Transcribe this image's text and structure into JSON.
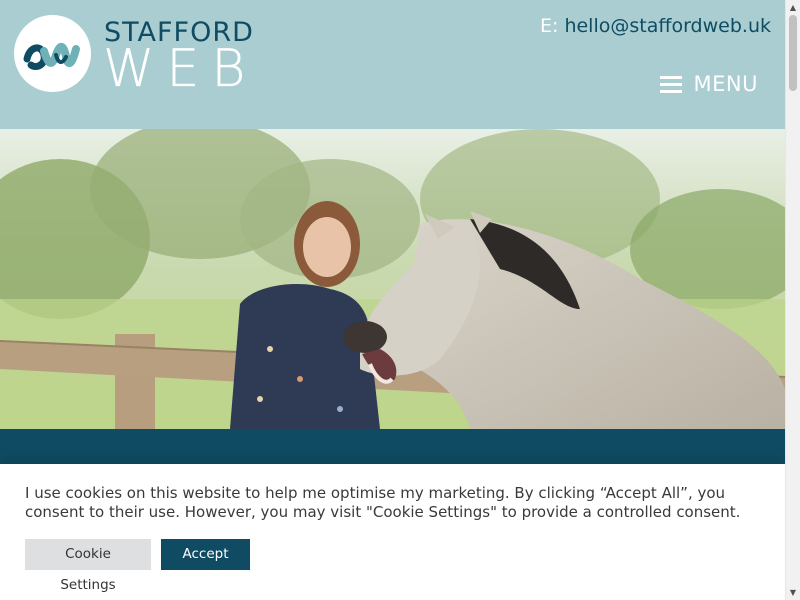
{
  "brand": {
    "logo_initials": "SW",
    "name_top": "STAFFORD",
    "name_bottom": "WEB"
  },
  "header": {
    "email_prefix": "E:",
    "email": "hello@staffordweb.uk",
    "menu_label": "MENU",
    "menu_icon": "hamburger-icon"
  },
  "hero": {
    "image": "woman-with-laughing-horse-photo"
  },
  "cookie_banner": {
    "message": "I use cookies on this website to help me optimise my marketing. By clicking “Accept All”, you consent to their use. However, you may visit \"Cookie Settings\" to provide a controlled consent.",
    "settings_button": "Cookie Settings",
    "accept_button": "Accept All"
  },
  "scrollbar": {
    "up_arrow": "▲",
    "down_arrow": "▼"
  },
  "colors": {
    "header_bg": "#a9cdd0",
    "brand_dark": "#0f4c63",
    "white": "#ffffff",
    "cookie_settings_bg": "#dedfe0"
  }
}
